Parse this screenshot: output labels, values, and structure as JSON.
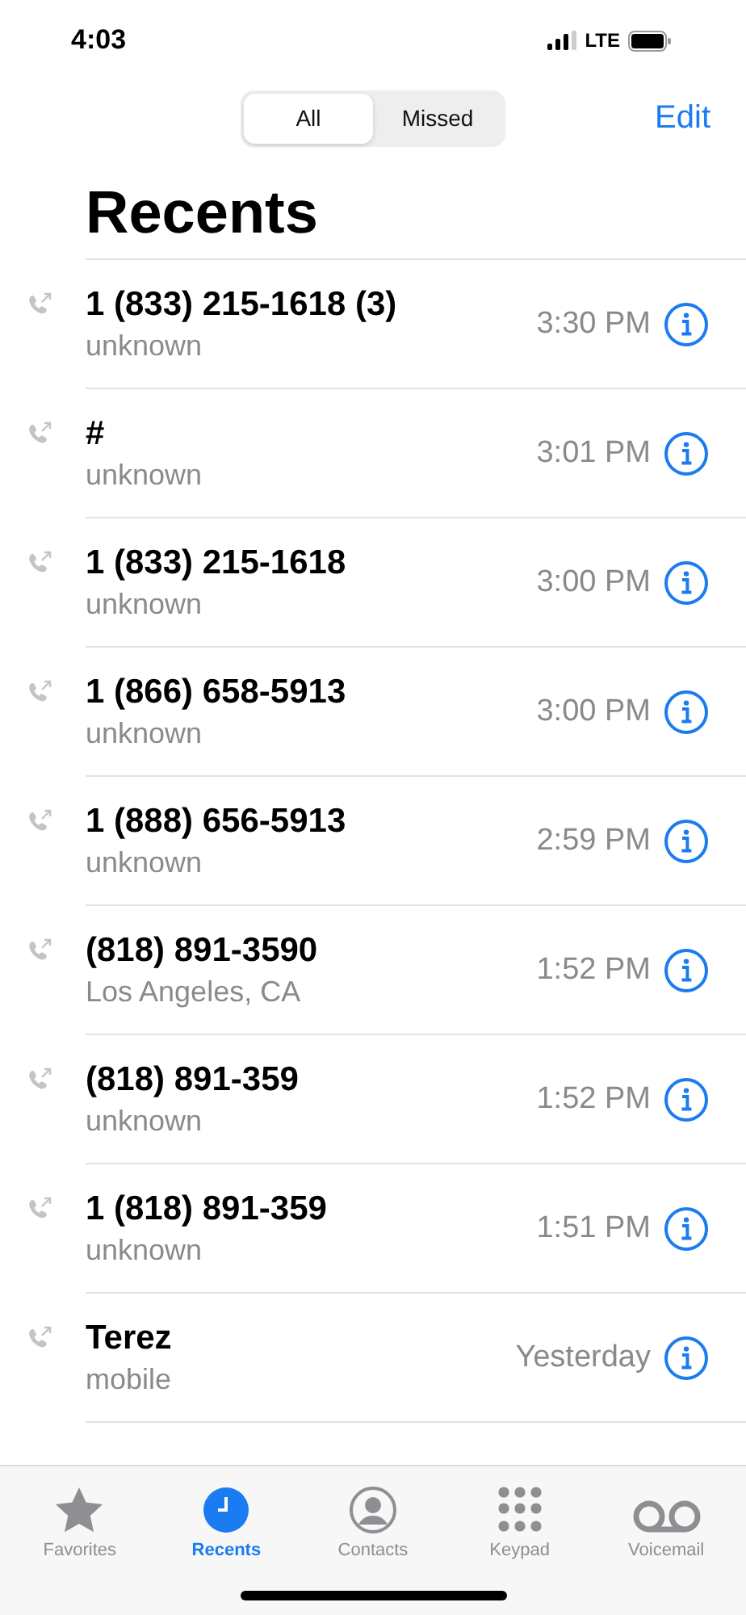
{
  "status_bar": {
    "time": "4:03",
    "network": "LTE"
  },
  "segments": [
    {
      "label": "All",
      "selected": true
    },
    {
      "label": "Missed",
      "selected": false
    }
  ],
  "edit_button": "Edit",
  "title": "Recents",
  "calls": [
    {
      "name": "1 (833) 215-1618 (3)",
      "detail": "unknown",
      "time": "3:30 PM"
    },
    {
      "name": "#",
      "detail": "unknown",
      "time": "3:01 PM"
    },
    {
      "name": "1 (833) 215-1618",
      "detail": "unknown",
      "time": "3:00 PM"
    },
    {
      "name": "1 (866) 658-5913",
      "detail": "unknown",
      "time": "3:00 PM"
    },
    {
      "name": "1 (888) 656-5913",
      "detail": "unknown",
      "time": "2:59 PM"
    },
    {
      "name": "(818) 891-3590",
      "detail": "Los Angeles, CA",
      "time": "1:52 PM"
    },
    {
      "name": "(818) 891-359",
      "detail": "unknown",
      "time": "1:52 PM"
    },
    {
      "name": "1 (818) 891-359",
      "detail": "unknown",
      "time": "1:51 PM"
    },
    {
      "name": "Terez",
      "detail": "mobile",
      "time": "Yesterday"
    }
  ],
  "tab_bar": [
    {
      "kind": "star",
      "label": "Favorites",
      "selected": false
    },
    {
      "kind": "clock",
      "label": "Recents",
      "selected": true
    },
    {
      "kind": "person",
      "label": "Contacts",
      "selected": false
    },
    {
      "kind": "keypad",
      "label": "Keypad",
      "selected": false
    },
    {
      "kind": "voicemail",
      "label": "Voicemail",
      "selected": false
    }
  ]
}
